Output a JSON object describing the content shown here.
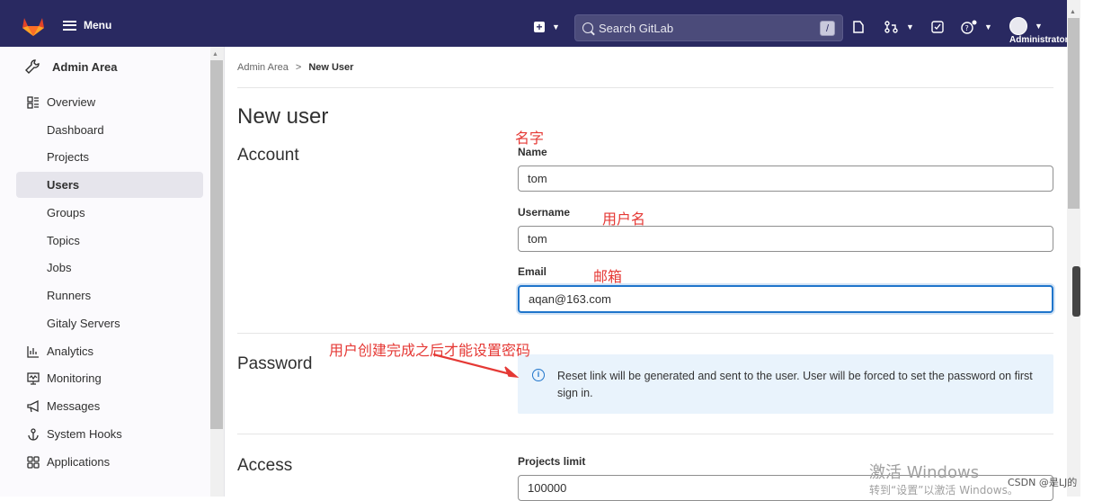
{
  "header": {
    "menu_label": "Menu",
    "search_placeholder": "Search GitLab",
    "search_shortcut": "/",
    "user_label": "Administrator"
  },
  "sidebar": {
    "title": "Admin Area",
    "items": [
      {
        "label": "Overview",
        "icon": "overview-icon",
        "level": "top"
      },
      {
        "label": "Dashboard",
        "level": "sub"
      },
      {
        "label": "Projects",
        "level": "sub"
      },
      {
        "label": "Users",
        "level": "sub",
        "active": true
      },
      {
        "label": "Groups",
        "level": "sub"
      },
      {
        "label": "Topics",
        "level": "sub"
      },
      {
        "label": "Jobs",
        "level": "sub"
      },
      {
        "label": "Runners",
        "level": "sub"
      },
      {
        "label": "Gitaly Servers",
        "level": "sub"
      },
      {
        "label": "Analytics",
        "icon": "chart-icon",
        "level": "top"
      },
      {
        "label": "Monitoring",
        "icon": "monitor-icon",
        "level": "top"
      },
      {
        "label": "Messages",
        "icon": "megaphone-icon",
        "level": "top"
      },
      {
        "label": "System Hooks",
        "icon": "hook-icon",
        "level": "top"
      },
      {
        "label": "Applications",
        "icon": "applications-icon",
        "level": "top"
      }
    ]
  },
  "breadcrumb": {
    "parent": "Admin Area",
    "separator": ">",
    "current": "New User"
  },
  "page": {
    "title": "New user",
    "account": {
      "heading": "Account",
      "name_label": "Name",
      "name_value": "tom",
      "username_label": "Username",
      "username_value": "tom",
      "email_label": "Email",
      "email_value": "aqan@163.com"
    },
    "password": {
      "heading": "Password",
      "info": "Reset link will be generated and sent to the user. User will be forced to set the password on first sign in."
    },
    "access": {
      "heading": "Access",
      "projects_limit_label": "Projects limit",
      "projects_limit_value": "100000"
    }
  },
  "annotations": {
    "name": "名字",
    "username": "用户名",
    "email": "邮箱",
    "password_note": "用户创建完成之后才能设置密码"
  },
  "overlay": {
    "watermark_line1": "激活 Windows",
    "watermark_line2": "转到“设置”以激活 Windows。",
    "csdn": "CSDN @是LJ的"
  },
  "colors": {
    "header_bg": "#292961",
    "accent": "#1f75cb",
    "annotation": "#e53935",
    "info_bg": "#e9f3fc"
  }
}
